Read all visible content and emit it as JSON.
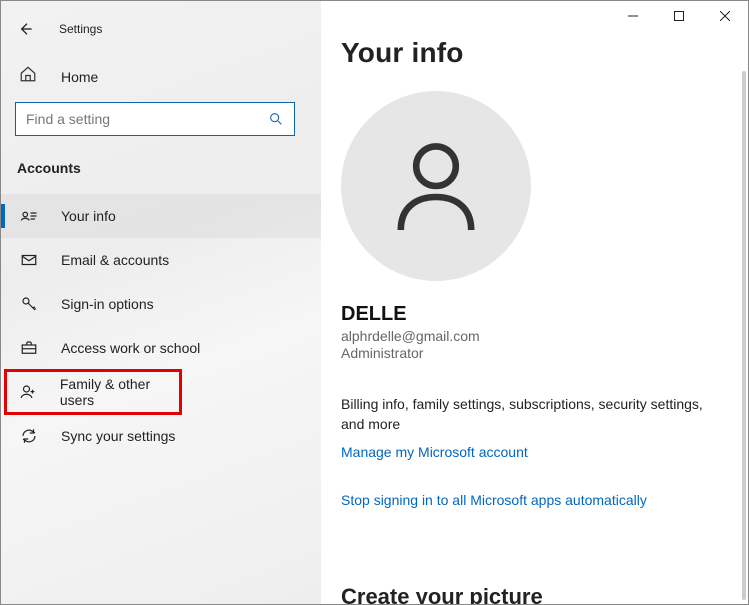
{
  "header": {
    "app_title": "Settings"
  },
  "sidebar": {
    "home_label": "Home",
    "search_placeholder": "Find a setting",
    "section_header": "Accounts",
    "items": [
      {
        "label": "Your info"
      },
      {
        "label": "Email & accounts"
      },
      {
        "label": "Sign-in options"
      },
      {
        "label": "Access work or school"
      },
      {
        "label": "Family & other users"
      },
      {
        "label": "Sync your settings"
      }
    ]
  },
  "main": {
    "page_title": "Your info",
    "user_name": "DELLE",
    "user_email": "alphrdelle@gmail.com",
    "user_role": "Administrator",
    "billing_text": "Billing info, family settings, subscriptions, security settings, and more",
    "manage_link": "Manage my Microsoft account",
    "stop_link": "Stop signing in to all Microsoft apps automatically",
    "section2_title": "Create your picture"
  }
}
